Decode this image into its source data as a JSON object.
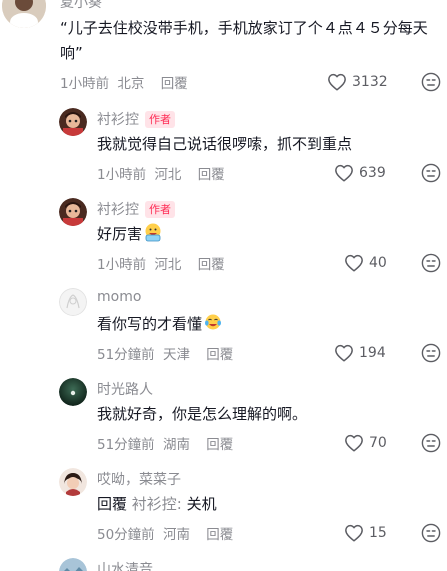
{
  "comments": [
    {
      "name": "夏小葵",
      "text": "“儿子去住校没带手机，手机放家订了个４点４５分每天响”",
      "time": "1小時前",
      "location": "北京",
      "reply_label": "回覆",
      "likes": "3132",
      "avatar_color": "#d8c7b3"
    },
    {
      "name": "衬衫控",
      "author_tag": "作者",
      "text": "我就觉得自己说话很啰嗦，抓不到重点",
      "time": "1小時前",
      "location": "河北",
      "reply_label": "回覆",
      "likes": "639",
      "avatar_color": "#6b3a2a"
    },
    {
      "name": "衬衫控",
      "author_tag": "作者",
      "text": "好厉害",
      "emoji": "applause-face-emoji",
      "time": "1小時前",
      "location": "河北",
      "reply_label": "回覆",
      "likes": "40",
      "avatar_color": "#6b3a2a"
    },
    {
      "name": "momo",
      "text": "看你写的才看懂",
      "emoji": "crying-laughing-face-emoji",
      "time": "51分鐘前",
      "location": "天津",
      "reply_label": "回覆",
      "likes": "194",
      "avatar_color": "#f2f2f2"
    },
    {
      "name": "时光路人",
      "text": "我就好奇，你是怎么理解的啊。",
      "time": "51分鐘前",
      "location": "湖南",
      "reply_label": "回覆",
      "likes": "70",
      "avatar_color": "#1f3b2e"
    },
    {
      "name": "哎呦，菜菜子",
      "reply_prefix": "回覆",
      "reply_to": "衬衫控:",
      "text": "关机",
      "time": "50分鐘前",
      "location": "河南",
      "reply_label": "回覆",
      "likes": "15",
      "avatar_color": "#8b5a4a"
    },
    {
      "name": "山水清音",
      "avatar_color": "#a8c4d8"
    }
  ],
  "icons": {
    "like": "heart-outline-icon",
    "more": "expressionless-face-icon"
  },
  "colors": {
    "text": "#161823",
    "secondary": "#8a8b91",
    "author_tag": "#fe2c55",
    "author_tag_bg": "#ffe3e8"
  }
}
